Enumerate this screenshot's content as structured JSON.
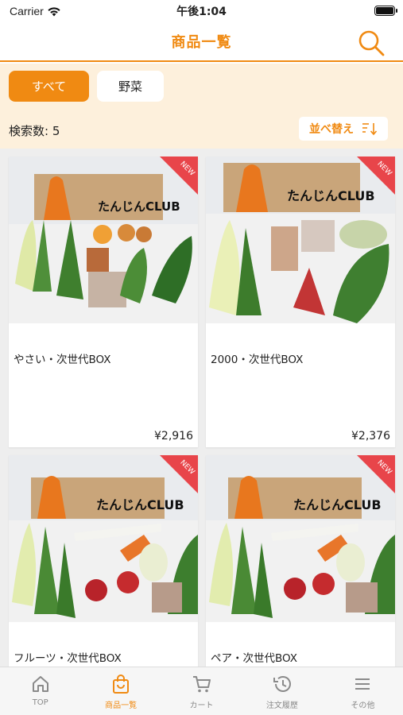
{
  "status": {
    "carrier": "Carrier",
    "time": "午後1:04"
  },
  "nav": {
    "title": "商品一覧",
    "search_icon": "search-icon"
  },
  "filters": {
    "chips": [
      {
        "label": "すべて",
        "selected": true
      },
      {
        "label": "野菜",
        "selected": false
      }
    ],
    "result_count": "検索数: 5",
    "sort_label": "並べ替え",
    "sort_icon": "sort-icon"
  },
  "products": [
    {
      "name": "やさい・次世代BOX",
      "price": "¥2,916",
      "badge": "NEW"
    },
    {
      "name": "2000・次世代BOX",
      "price": "¥2,376",
      "badge": "NEW"
    },
    {
      "name": "フルーツ・次世代BOX",
      "price": "",
      "badge": "NEW"
    },
    {
      "name": "ペア・次世代BOX",
      "price": "",
      "badge": "NEW"
    }
  ],
  "box_logo_text": "たんじんCLUB",
  "tabs": [
    {
      "label": "TOP",
      "icon": "home-icon",
      "active": false
    },
    {
      "label": "商品一覧",
      "icon": "shopping-bag-icon",
      "active": true
    },
    {
      "label": "カート",
      "icon": "cart-icon",
      "active": false
    },
    {
      "label": "注文履歴",
      "icon": "history-icon",
      "active": false
    },
    {
      "label": "その他",
      "icon": "menu-icon",
      "active": false
    }
  ],
  "colors": {
    "accent": "#f08a12",
    "badge": "#e8454a",
    "filter_bg": "#fdf0dc",
    "grid_bg": "#eeeeee"
  }
}
